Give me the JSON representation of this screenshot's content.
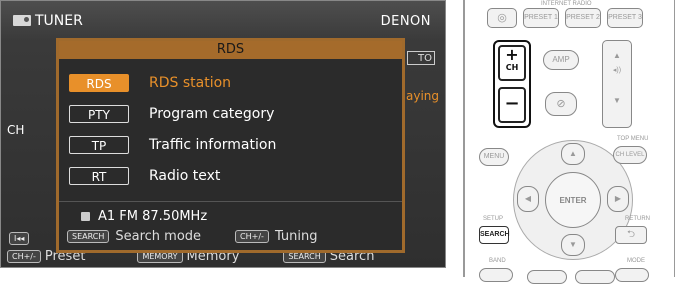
{
  "screen": {
    "source_title": "TUNER",
    "brand": "DENON",
    "bg_auto": "TO",
    "bg_playing": "aying",
    "bg_ch": "CH",
    "bottom": {
      "preset_chip": "CH+/-",
      "preset_label": "Preset",
      "memory_chip": "MEMORY",
      "memory_label": "Memory",
      "search_chip": "SEARCH",
      "search_label": "Search",
      "left_chip": "I◂◂"
    }
  },
  "panel": {
    "title": "RDS",
    "items": [
      {
        "tag": "RDS",
        "label": "RDS station",
        "selected": true
      },
      {
        "tag": "PTY",
        "label": "Program category",
        "selected": false
      },
      {
        "tag": "TP",
        "label": "Traffic information",
        "selected": false
      },
      {
        "tag": "RT",
        "label": "Radio text",
        "selected": false
      }
    ],
    "station": "A1 FM 87.50MHz",
    "footer": {
      "search_chip": "SEARCH",
      "search_label": "Search mode",
      "tuning_chip": "CH+/-",
      "tuning_label": "Tuning"
    }
  },
  "remote": {
    "internet_radio": "INTERNET RADIO",
    "preset1": "PRESET 1",
    "preset2": "PRESET 2",
    "preset3": "PRESET 3",
    "amp": "AMP",
    "ch": "CH",
    "menu": "MENU",
    "top_menu": "TOP MENU",
    "ch_level": "CH LEVEL",
    "enter": "ENTER",
    "setup": "SETUP",
    "search": "SEARCH",
    "return": "RETURN",
    "band": "BAND",
    "mode": "MODE"
  },
  "colors": {
    "accent": "#e8902a",
    "panel_border": "#a06a2c"
  }
}
